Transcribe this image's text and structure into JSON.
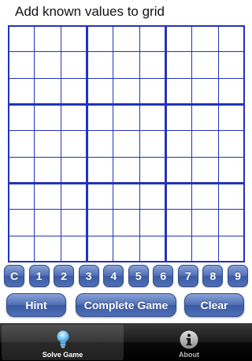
{
  "header": {
    "title": "Add known values to grid"
  },
  "grid": {
    "rows": 9,
    "cols": 9,
    "line_color": "#2233bb"
  },
  "numpad": {
    "keys": [
      "C",
      "1",
      "2",
      "3",
      "4",
      "5",
      "6",
      "7",
      "8",
      "9"
    ]
  },
  "actions": {
    "hint_label": "Hint",
    "complete_label": "Complete Game",
    "clear_label": "Clear"
  },
  "tabbar": {
    "tabs": [
      {
        "label": "Solve Game",
        "icon": "lightbulb-icon",
        "selected": true
      },
      {
        "label": "About",
        "icon": "info-icon",
        "selected": false
      }
    ]
  },
  "colors": {
    "accent": "#4e6db4",
    "grid": "#2233bb",
    "tabbar": "#1a1a1a"
  }
}
